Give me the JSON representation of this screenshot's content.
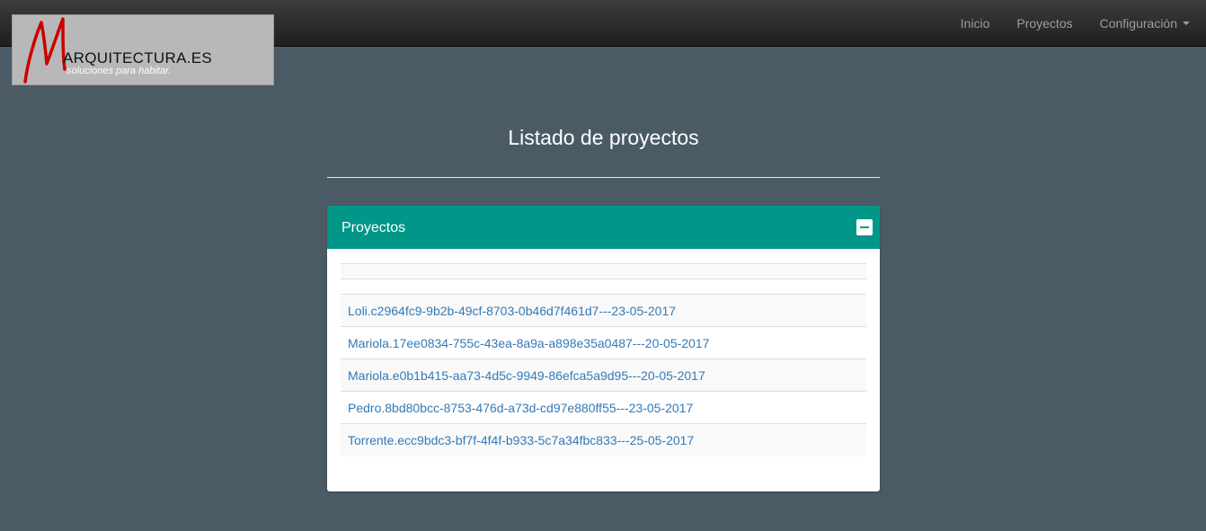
{
  "logo": {
    "main_text": "ARQUITECTURA.ES",
    "tagline": "soluciones para habitar.",
    "letter": "M"
  },
  "nav": {
    "items": [
      {
        "label": "Inicio"
      },
      {
        "label": "Proyectos"
      },
      {
        "label": "Configuración"
      }
    ]
  },
  "page": {
    "title": "Listado de proyectos"
  },
  "panel": {
    "title": "Proyectos",
    "collapse_icon": "minus-square-icon",
    "projects": [
      "Loli.c2964fc9-9b2b-49cf-8703-0b46d7f461d7---23-05-2017",
      "Mariola.17ee0834-755c-43ea-8a9a-a898e35a0487---20-05-2017",
      "Mariola.e0b1b415-aa73-4d5c-9949-86efca5a9d95---20-05-2017",
      "Pedro.8bd80bcc-8753-476d-a73d-cd97e880ff55---23-05-2017",
      "Torrente.ecc9bdc3-bf7f-4f4f-b933-5c7a34fbc833---25-05-2017"
    ]
  },
  "colors": {
    "background": "#4a5b66",
    "navbar": "#222222",
    "panel_header": "#009688",
    "link": "#337ab7",
    "logo_red": "#cc0000"
  }
}
